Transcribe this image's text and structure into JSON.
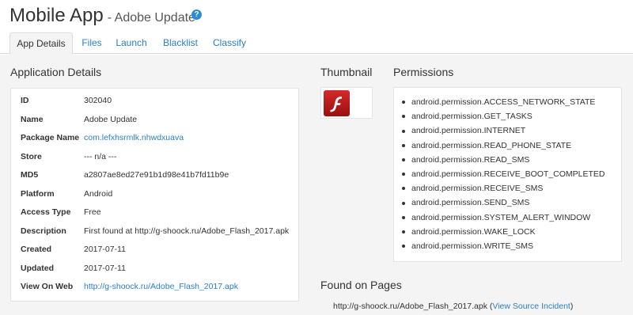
{
  "header": {
    "title": "Mobile App",
    "subtitle": "- Adobe Update",
    "help_icon": "?"
  },
  "tabs": [
    {
      "label": "App Details",
      "active": true
    },
    {
      "label": "Files",
      "active": false
    },
    {
      "label": "Launch",
      "active": false
    },
    {
      "label": "Blacklist",
      "active": false
    },
    {
      "label": "Classify",
      "active": false
    }
  ],
  "details": {
    "heading": "Application Details",
    "rows": [
      {
        "key": "ID",
        "value": "302040"
      },
      {
        "key": "Name",
        "value": "Adobe Update"
      },
      {
        "key": "Package Name",
        "value": "com.lefxhsrmlk.nhwdxuava"
      },
      {
        "key": "Store",
        "value": "--- n/a ---"
      },
      {
        "key": "MD5",
        "value": "a2807ae8ed27e91b1d98e41b7fd11b9e"
      },
      {
        "key": "Platform",
        "value": "Android"
      },
      {
        "key": "Access Type",
        "value": "Free"
      },
      {
        "key": "Description",
        "value": "First found at http://g-shoock.ru/Adobe_Flash_2017.apk"
      },
      {
        "key": "Created",
        "value": "2017-07-11"
      },
      {
        "key": "Updated",
        "value": "2017-07-11"
      },
      {
        "key": "View On Web",
        "value": "http://g-shoock.ru/Adobe_Flash_2017.apk"
      }
    ]
  },
  "thumbnail": {
    "heading": "Thumbnail",
    "icon": "flash-player-icon",
    "letter": "f"
  },
  "permissions": {
    "heading": "Permissions",
    "items": [
      "android.permission.ACCESS_NETWORK_STATE",
      "android.permission.GET_TASKS",
      "android.permission.INTERNET",
      "android.permission.READ_PHONE_STATE",
      "android.permission.READ_SMS",
      "android.permission.RECEIVE_BOOT_COMPLETED",
      "android.permission.RECEIVE_SMS",
      "android.permission.SEND_SMS",
      "android.permission.SYSTEM_ALERT_WINDOW",
      "android.permission.WAKE_LOCK",
      "android.permission.WRITE_SMS"
    ]
  },
  "found": {
    "heading": "Found on Pages",
    "url": "http://g-shoock.ru/Adobe_Flash_2017.apk",
    "open_paren": "(",
    "link": "View Source Incident",
    "close_paren": ")"
  },
  "colors": {
    "link": "#2a7fc6",
    "panel_bg": "#f4f4f4",
    "flash_red": "#c41e1e"
  }
}
